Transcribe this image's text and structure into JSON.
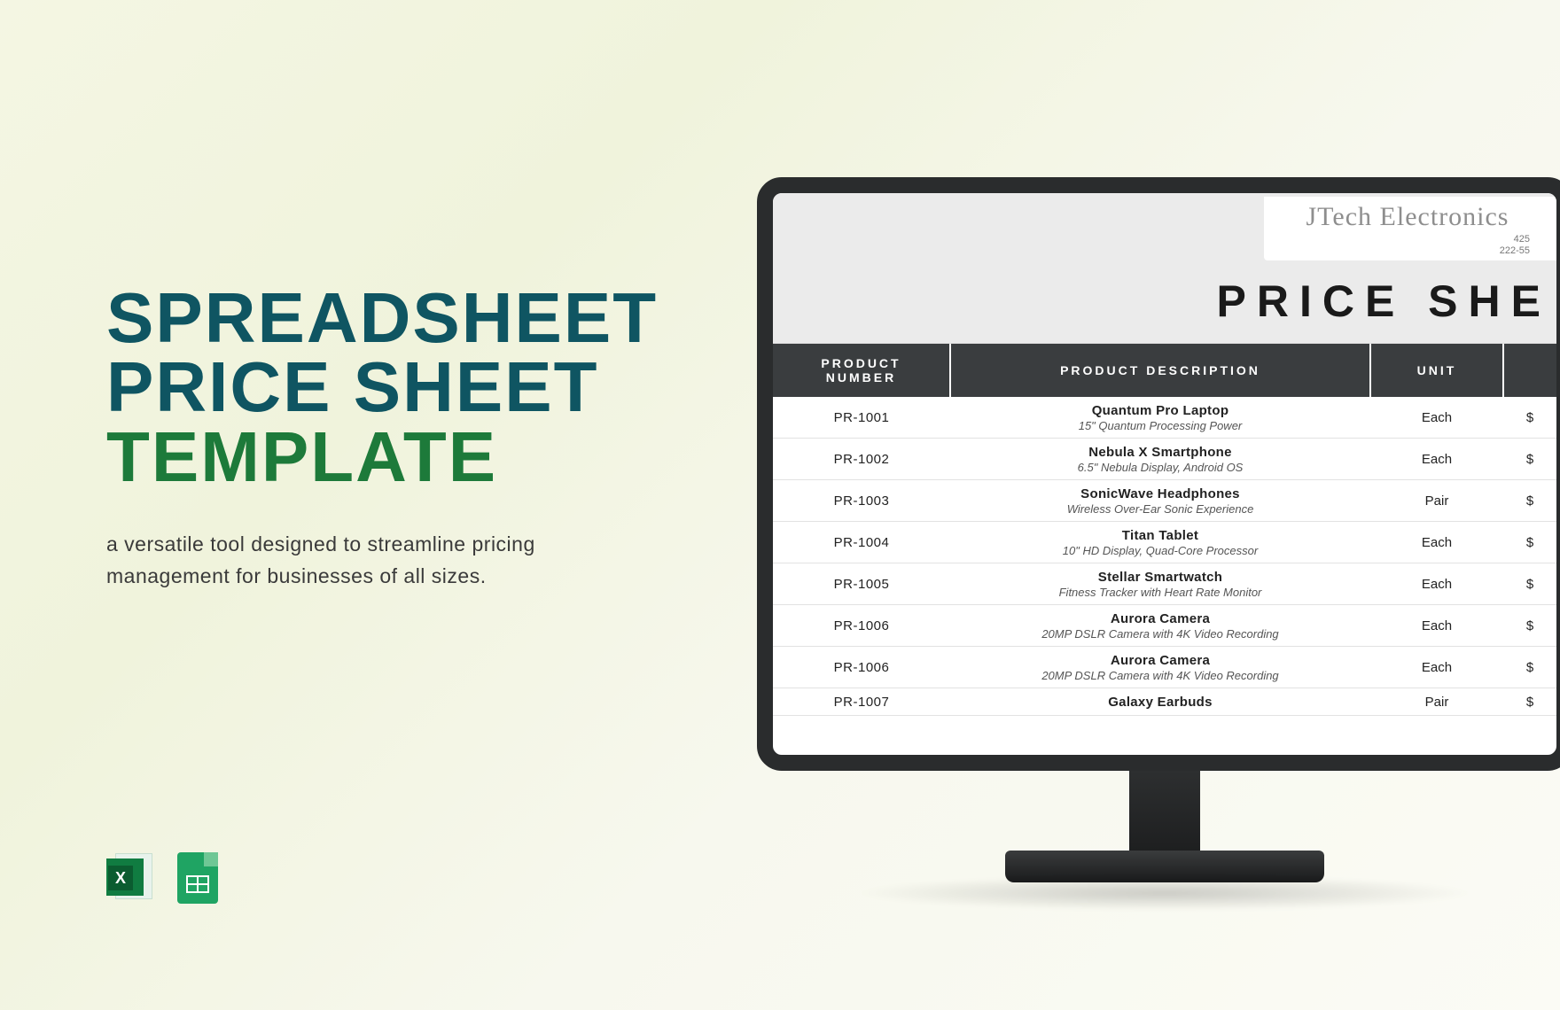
{
  "headline": {
    "line1": "SPREADSHEET",
    "line2": "PRICE SHEET",
    "line3": "TEMPLATE"
  },
  "subhead": "a versatile tool designed to streamline pricing management for businesses of all sizes.",
  "icons": {
    "excel_letter": "X"
  },
  "sheet": {
    "brand_name": "JTech Electronics",
    "brand_meta_line1": "425",
    "brand_meta_line2": "222-55",
    "title": "PRICE SHE",
    "columns": {
      "number_l1": "PRODUCT",
      "number_l2": "NUMBER",
      "description": "PRODUCT DESCRIPTION",
      "unit": "UNIT",
      "price_symbol": "$"
    },
    "rows": [
      {
        "num": "PR-1001",
        "name": "Quantum Pro Laptop",
        "sub": "15\" Quantum Processing Power",
        "unit": "Each",
        "price": "$"
      },
      {
        "num": "PR-1002",
        "name": "Nebula X Smartphone",
        "sub": "6.5\" Nebula Display, Android OS",
        "unit": "Each",
        "price": "$"
      },
      {
        "num": "PR-1003",
        "name": "SonicWave Headphones",
        "sub": "Wireless Over-Ear Sonic Experience",
        "unit": "Pair",
        "price": "$"
      },
      {
        "num": "PR-1004",
        "name": "Titan Tablet",
        "sub": "10\" HD Display, Quad-Core Processor",
        "unit": "Each",
        "price": "$"
      },
      {
        "num": "PR-1005",
        "name": "Stellar Smartwatch",
        "sub": "Fitness Tracker with Heart Rate Monitor",
        "unit": "Each",
        "price": "$"
      },
      {
        "num": "PR-1006",
        "name": "Aurora Camera",
        "sub": "20MP DSLR Camera with 4K Video Recording",
        "unit": "Each",
        "price": "$"
      },
      {
        "num": "PR-1006",
        "name": "Aurora Camera",
        "sub": "20MP DSLR Camera with 4K Video Recording",
        "unit": "Each",
        "price": "$"
      },
      {
        "num": "PR-1007",
        "name": "Galaxy Earbuds",
        "sub": "",
        "unit": "Pair",
        "price": "$"
      }
    ]
  }
}
